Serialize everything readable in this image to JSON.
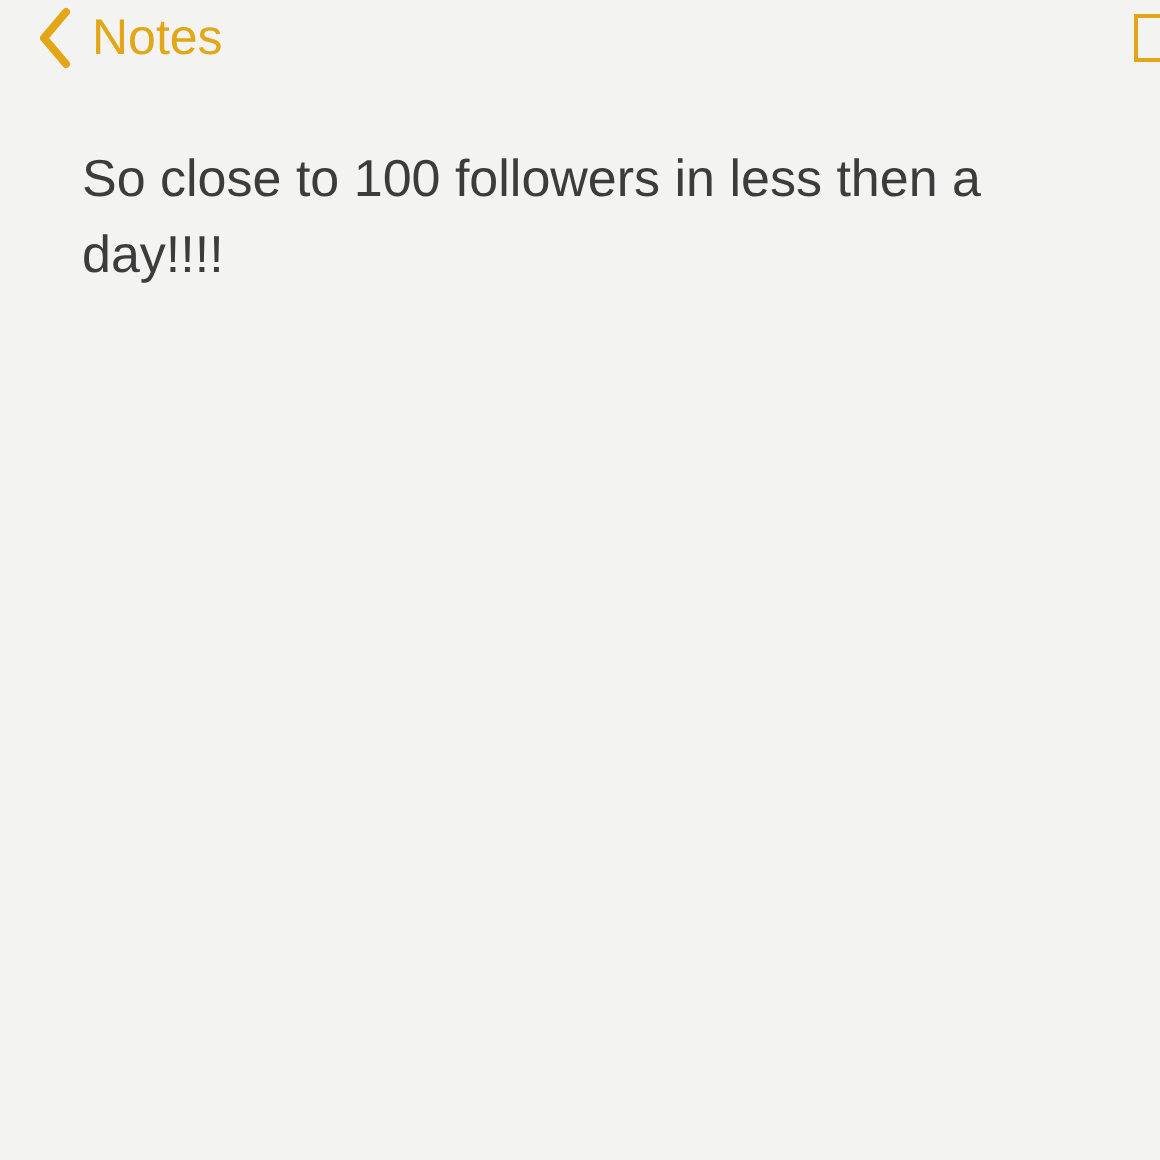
{
  "nav": {
    "back_label": "Notes"
  },
  "note": {
    "body": "So close to 100 followers in less then a day!!!!"
  }
}
